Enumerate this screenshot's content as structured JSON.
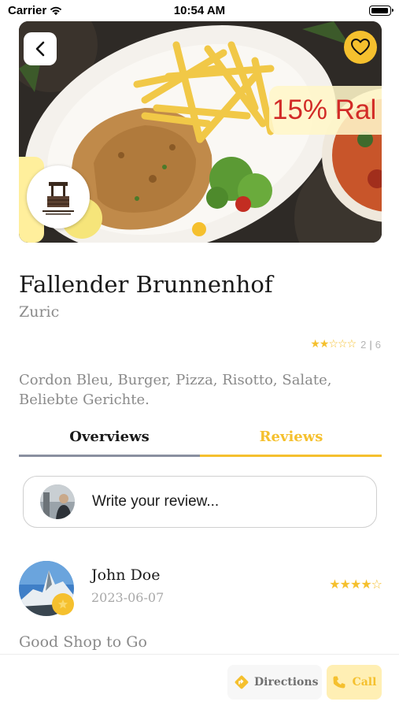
{
  "status_bar": {
    "carrier": "Carrier",
    "time": "10:54 AM",
    "icons": [
      "wifi-icon",
      "battery-icon"
    ]
  },
  "hero": {
    "promo_text": "15% Ral",
    "image": "photo of schnitzel with french fries and salad on a plate",
    "logo": "restaurant logo with a well",
    "carousel_active_index": 0,
    "icons": [
      "back-icon",
      "heart-icon"
    ]
  },
  "restaurant": {
    "name": "Fallender Brunnenhof",
    "city": "Zuric",
    "rating": {
      "stars_filled": 2,
      "stars_total": 6,
      "stars_glyphs": "★★☆☆☆",
      "score": "2",
      "separator": "|",
      "count": "6"
    },
    "cuisines": "Cordon Bleu, Burger, Pizza, Risotto, Salate, Beliebte Gerichte."
  },
  "tabs": [
    {
      "label": "Overviews",
      "active": false
    },
    {
      "label": "Reviews",
      "active": true
    }
  ],
  "write_review": {
    "placeholder": "Write your review..."
  },
  "reviews": [
    {
      "name": "John Doe",
      "date": "2023-06-07",
      "stars": 4,
      "stars_glyphs": "★★★★☆",
      "text": "Good Shop to Go"
    }
  ],
  "actions": {
    "directions_label": "Directions",
    "call_label": "Call"
  },
  "colors": {
    "accent": "#f5c02e",
    "promo_red": "#d22b27",
    "muted_text": "#8a8a8a",
    "tab_inactive_line": "#8a90a0"
  }
}
